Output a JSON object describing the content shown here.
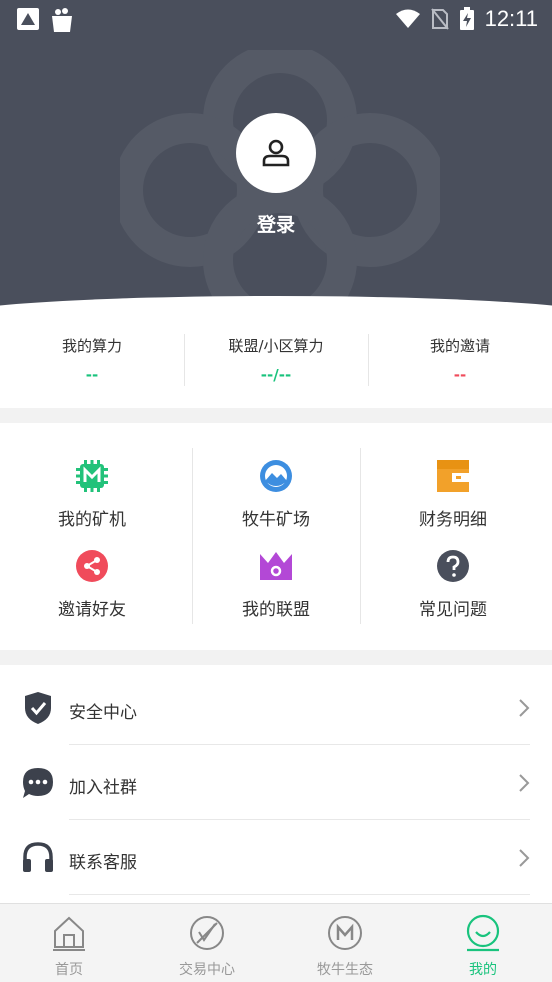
{
  "status_bar": {
    "time": "12:11"
  },
  "profile": {
    "login_label": "登录"
  },
  "stats": [
    {
      "label": "我的算力",
      "value": "--",
      "color": "#19c37d"
    },
    {
      "label": "联盟/小区算力",
      "value": "--/--",
      "color": "#19c37d"
    },
    {
      "label": "我的邀请",
      "value": "--",
      "color": "#f04b5b"
    }
  ],
  "grid": [
    {
      "label": "我的矿机",
      "icon": "miner-icon",
      "color": "#22c27a"
    },
    {
      "label": "牧牛矿场",
      "icon": "mining-field-icon",
      "color": "#3d8ee0"
    },
    {
      "label": "财务明细",
      "icon": "wallet-icon",
      "color": "#f2a12a"
    },
    {
      "label": "邀请好友",
      "icon": "share-icon",
      "color": "#f04b5b"
    },
    {
      "label": "我的联盟",
      "icon": "crown-icon",
      "color": "#b348d6"
    },
    {
      "label": "常见问题",
      "icon": "question-icon",
      "color": "#4a4f5c"
    }
  ],
  "list": [
    {
      "label": "安全中心",
      "icon": "shield-icon"
    },
    {
      "label": "加入社群",
      "icon": "chat-icon"
    },
    {
      "label": "联系客服",
      "icon": "headset-icon"
    }
  ],
  "bottom_nav": [
    {
      "label": "首页",
      "icon": "home-icon",
      "active": false
    },
    {
      "label": "交易中心",
      "icon": "trade-icon",
      "active": false
    },
    {
      "label": "牧牛生态",
      "icon": "ecology-icon",
      "active": false
    },
    {
      "label": "我的",
      "icon": "smile-icon",
      "active": true
    }
  ],
  "colors": {
    "header_bg": "#4a4f5c",
    "accent": "#19c37d",
    "danger": "#f04b5b"
  }
}
